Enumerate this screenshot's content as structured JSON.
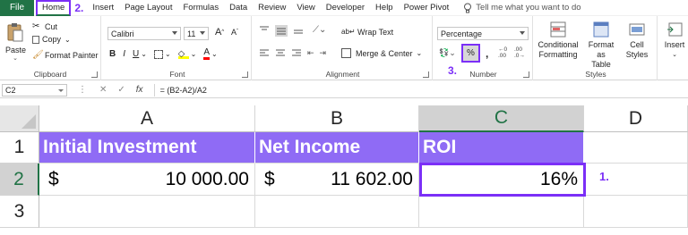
{
  "menu": {
    "file": "File",
    "tabs": [
      "Home",
      "Insert",
      "Page Layout",
      "Formulas",
      "Data",
      "Review",
      "View",
      "Developer",
      "Help",
      "Power Pivot"
    ],
    "step2": "2.",
    "tell_me": "Tell me what you want to do"
  },
  "ribbon": {
    "clipboard": {
      "paste": "Paste",
      "cut": "Cut",
      "copy": "Copy",
      "format_painter": "Format Painter",
      "label": "Clipboard"
    },
    "font": {
      "name": "Calibri",
      "size": "11",
      "grow": "A",
      "shrink": "A",
      "bold": "B",
      "italic": "I",
      "underline": "U",
      "color_letter": "A",
      "label": "Font"
    },
    "alignment": {
      "wrap": "Wrap Text",
      "merge": "Merge & Center",
      "label": "Alignment"
    },
    "number": {
      "format": "Percentage",
      "percent": "%",
      "comma": ",",
      "inc": ".00",
      "dec": ".0",
      "step3": "3.",
      "label": "Number"
    },
    "styles": {
      "conditional_1": "Conditional",
      "conditional_2": "Formatting",
      "format_as_1": "Format as",
      "format_as_2": "Table",
      "cell_1": "Cell",
      "cell_2": "Styles",
      "label": "Styles"
    },
    "cells": {
      "insert": "Insert"
    }
  },
  "formula_bar": {
    "name_box": "C2",
    "cancel": "✕",
    "enter": "✓",
    "fx": "fx",
    "formula": "= (B2-A2)/A2"
  },
  "grid": {
    "columns": [
      "A",
      "B",
      "C",
      "D"
    ],
    "rows": [
      "1",
      "2",
      "3"
    ],
    "row1": {
      "a": "Initial Investment",
      "b": "Net Income",
      "c": "ROI"
    },
    "row2": {
      "a_sym": "$",
      "a_val": "10 000.00",
      "b_sym": "$",
      "b_val": "11 602.00",
      "c": "16%"
    },
    "step1": "1."
  },
  "colors": {
    "accent": "#7b2ff7",
    "header_fill": "#8f6bf5",
    "excel_green": "#217346"
  }
}
